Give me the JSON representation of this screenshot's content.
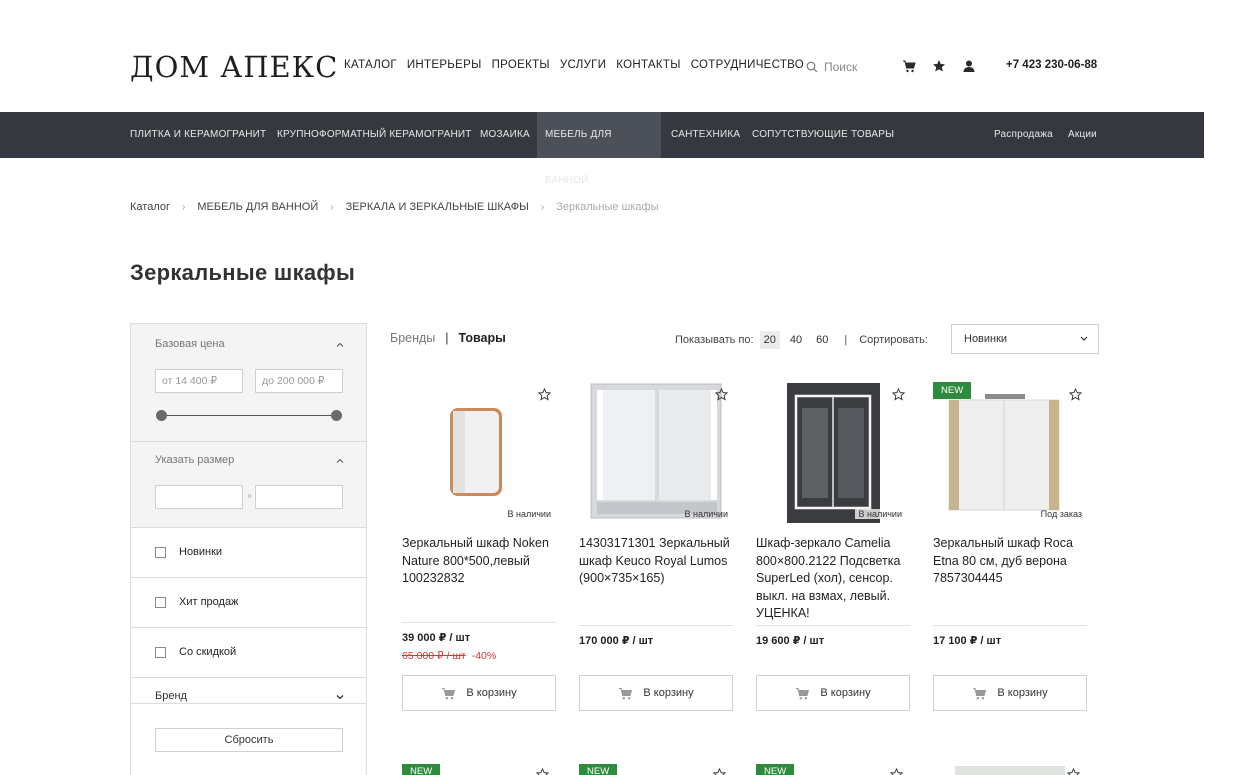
{
  "header": {
    "logo": "ДОМ АПЕКС",
    "nav": [
      "КАТАЛОГ",
      "ИНТЕРЬЕРЫ",
      "ПРОЕКТЫ",
      "УСЛУГИ",
      "КОНТАКТЫ",
      "СОТРУДНИЧЕСТВО"
    ],
    "search_placeholder": "Поиск",
    "phone": "+7 423 230-06-88"
  },
  "catbar": {
    "items": [
      "ПЛИТКА И КЕРАМОГРАНИТ",
      "КРУПНОФОРМАТНЫЙ КЕРАМОГРАНИТ",
      "МОЗАИКА",
      "МЕБЕЛЬ ДЛЯ ВАННОЙ",
      "САНТЕХНИКА",
      "СОПУТСТВУЮЩИЕ ТОВАРЫ"
    ],
    "right": [
      "Распродажа",
      "Акции"
    ]
  },
  "breadcrumb": [
    "Каталог",
    "МЕБЕЛЬ ДЛЯ ВАННОЙ",
    "ЗЕРКАЛА И ЗЕРКАЛЬНЫЕ ШКАФЫ",
    "Зеркальные шкафы"
  ],
  "page_title": "Зеркальные шкафы",
  "filters": {
    "price_label": "Базовая цена",
    "price_from": "от 14 400 ₽",
    "price_to": "до 200 000 ₽",
    "size_label": "Указать размер",
    "size_sep": "×",
    "checks": [
      "Новинки",
      "Хит продаж",
      "Со скидкой"
    ],
    "brand_label": "Бренд",
    "reset_label": "Сбросить"
  },
  "toolbar": {
    "tab_brands": "Бренды",
    "tab_sep": "|",
    "tab_products": "Товары",
    "perpage_label": "Показывать по:",
    "perpage": [
      "20",
      "40",
      "60"
    ],
    "pipe": "|",
    "sort_label": "Сортировать:",
    "sort_value": "Новинки"
  },
  "products": [
    {
      "name": "Зеркальный шкаф Noken Nature 800*500,левый 100232832",
      "price": "39 000 ₽ / шт",
      "old_price": "65 000 ₽ / шт",
      "discount": "-40%",
      "stock": "В наличии",
      "badge": ""
    },
    {
      "name": "14303171301 Зеркальный шкаф Keuco Royal Lumos (900×735×165)",
      "price": "170 000 ₽ / шт",
      "stock": "В наличии",
      "badge": ""
    },
    {
      "name": "Шкаф-зеркало Camelia 800×800.2122 Подсветка SuperLed (хол), сенсор. выкл. на взмах, левый. УЦЕНКА!",
      "price": "19 600 ₽ / шт",
      "stock": "В наличии",
      "badge": ""
    },
    {
      "name": "Зеркальный шкаф Roca Etna 80 см, дуб верона 7857304445",
      "price": "17 100 ₽ / шт",
      "stock": "Под заказ",
      "badge": "NEW"
    }
  ],
  "cart_label": "В корзину",
  "bottom_badges": [
    "NEW",
    "NEW",
    "NEW"
  ]
}
